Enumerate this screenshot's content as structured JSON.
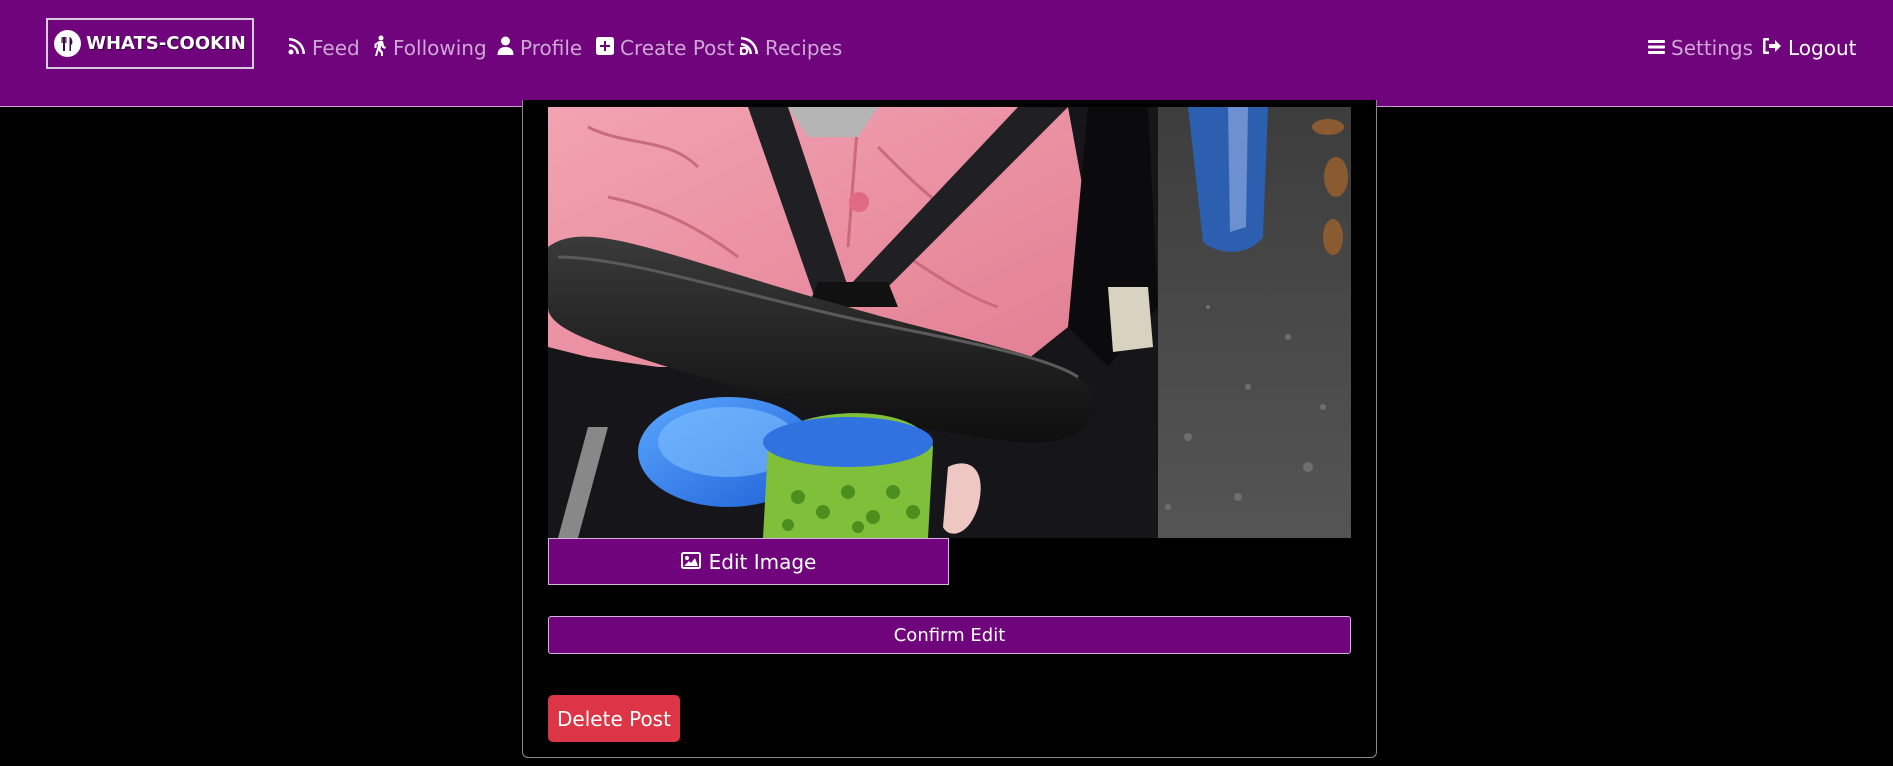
{
  "brand": {
    "name": "WHATS-COOKIN"
  },
  "nav": {
    "left": [
      {
        "label": "Feed",
        "icon": "rss-icon"
      },
      {
        "label": "Following",
        "icon": "walking-icon"
      },
      {
        "label": "Profile",
        "icon": "user-icon"
      },
      {
        "label": "Create Post",
        "icon": "plus-square-icon"
      },
      {
        "label": "Recipes",
        "icon": "blog-icon"
      }
    ],
    "right": [
      {
        "label": "Settings",
        "icon": "bars-icon"
      },
      {
        "label": "Logout",
        "icon": "sign-out-icon"
      }
    ]
  },
  "post": {
    "image_alt": "post photo",
    "edit_image_label": "Edit Image",
    "confirm_label": "Confirm Edit",
    "delete_label": "Delete Post"
  },
  "colors": {
    "brand_purple": "#6f047c",
    "nav_inactive_text": "#cfa6d6",
    "danger": "#dc3545",
    "background": "#000000"
  }
}
